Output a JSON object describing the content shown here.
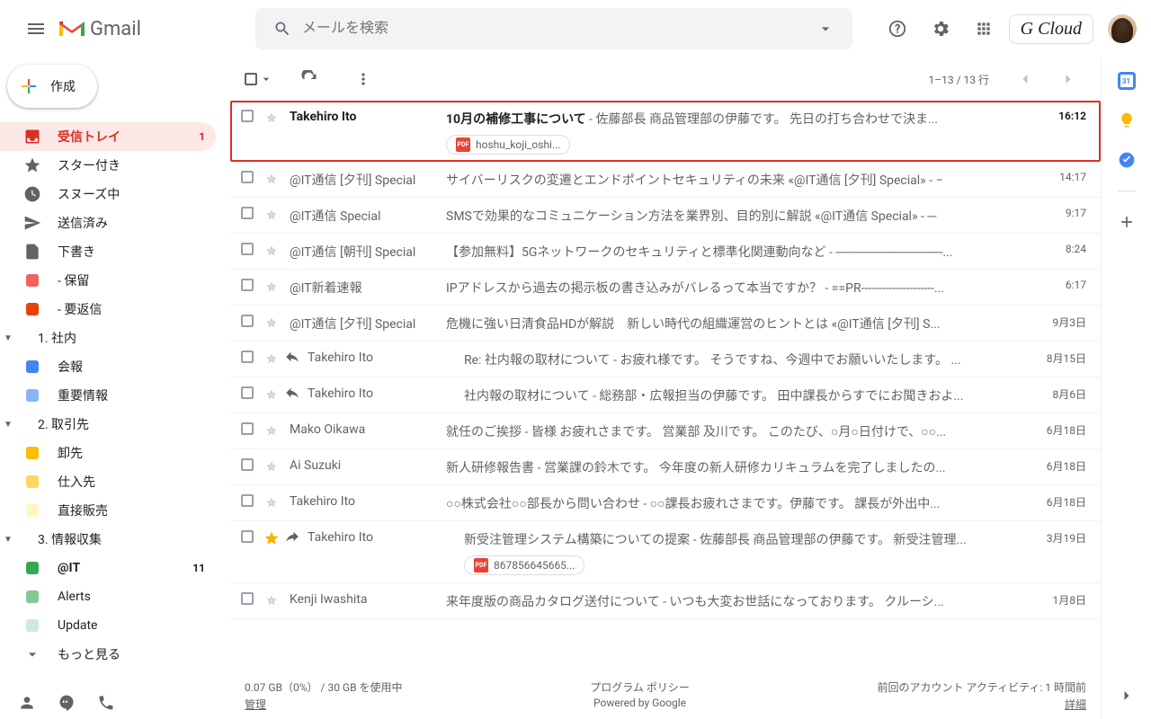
{
  "header": {
    "product": "Gmail",
    "search_placeholder": "メールを検索",
    "brand": "G Cloud"
  },
  "compose": "作成",
  "nav": {
    "inbox": "受信トレイ",
    "inbox_count": "1",
    "starred": "スター付き",
    "snoozed": "スヌーズ中",
    "sent": "送信済み",
    "drafts": "下書き",
    "pending": "- 保留",
    "reply_needed": "- 要返信",
    "group1": "1. 社内",
    "group1a": "会報",
    "group1b": "重要情報",
    "group2": "2. 取引先",
    "group2a": "卸先",
    "group2b": "仕入先",
    "group2c": "直接販売",
    "group3": "3. 情報収集",
    "group3a": "@IT",
    "group3a_count": "11",
    "group3b": "Alerts",
    "group3c": "Update",
    "more": "もっと見る"
  },
  "toolbar": {
    "pager": "1–13 / 13 行"
  },
  "mails": [
    {
      "sender": "Takehiro Ito",
      "subject": "10月の補修工事について",
      "snippet": " - 佐藤部長 商品管理部の伊藤です。 先日の打ち合わせで決ま...",
      "time": "16:12",
      "unread": true,
      "highlighted": true,
      "attachment": "hoshu_koji_oshi..."
    },
    {
      "sender": "@IT通信 [夕刊] Special",
      "subject": "サイバーリスクの変遷とエンドポイントセキュリティの未来 «@IT通信 [夕刊] Special»",
      "snippet": " - −",
      "time": "14:17"
    },
    {
      "sender": "@IT通信 Special",
      "subject": "SMSで効果的なコミュニケーション方法を業界別、目的別に解説 «@IT通信 Special»",
      "snippet": " - ─",
      "time": "9:17"
    },
    {
      "sender": "@IT通信 [朝刊] Special",
      "subject": "【参加無料】5Gネットワークのセキュリティと標準化関連動向など",
      "snippet": " - ────────────...",
      "time": "8:24"
    },
    {
      "sender": "@IT新着速報",
      "subject": "IPアドレスから過去の掲示板の書き込みがバレるって本当ですか？",
      "snippet": " - ==PR---------------------...",
      "time": "6:17"
    },
    {
      "sender": "@IT通信 [夕刊] Special",
      "subject": "危機に強い日清食品HDが解説　新しい時代の組織運営のヒントとは «@IT通信 [夕刊] S...",
      "snippet": "",
      "time": "9月3日"
    },
    {
      "sender": "Takehiro Ito",
      "subject": "Re: 社内報の取材について",
      "snippet": " - お疲れ様です。 そうですね、今週中でお願いいたします。 ...",
      "time": "8月15日",
      "reply": true
    },
    {
      "sender": "Takehiro Ito",
      "subject": "社内報の取材について",
      "snippet": " - 総務部・広報担当の伊藤です。 田中課長からすでにお聞きおよ...",
      "time": "8月6日",
      "reply": true
    },
    {
      "sender": "Mako Oikawa",
      "subject": "就任のご挨拶",
      "snippet": " - 皆様 お疲れさまです。 営業部 及川です。 このたび、○月○日付けで、○○...",
      "time": "6月18日"
    },
    {
      "sender": "Ai Suzuki",
      "subject": "新人研修報告書",
      "snippet": " - 営業課の鈴木です。 今年度の新人研修カリキュラムを完了しましたの...",
      "time": "6月18日"
    },
    {
      "sender": "Takehiro Ito",
      "subject": "○○株式会社○○部長から問い合わせ",
      "snippet": " - ○○課長お疲れさまです。伊藤です。 課長が外出中...",
      "time": "6月18日"
    },
    {
      "sender": "Takehiro Ito",
      "subject": "新受注管理システム構築についての提案",
      "snippet": " - 佐藤部長 商品管理部の伊藤です。 新受注管理...",
      "time": "3月19日",
      "starred": true,
      "forward": true,
      "attachment": "867856645665..."
    },
    {
      "sender": "Kenji Iwashita",
      "subject": "来年度版の商品カタログ送付について",
      "snippet": " - いつも大変お世話になっております。 クルーシ...",
      "time": "1月8日"
    }
  ],
  "footer": {
    "storage": "0.07 GB（0%） / 30 GB を使用中",
    "manage": "管理",
    "policy": "プログラム ポリシー",
    "powered": "Powered by Google",
    "activity": "前回のアカウント アクティビティ: 1 時間前",
    "details": "詳細"
  }
}
